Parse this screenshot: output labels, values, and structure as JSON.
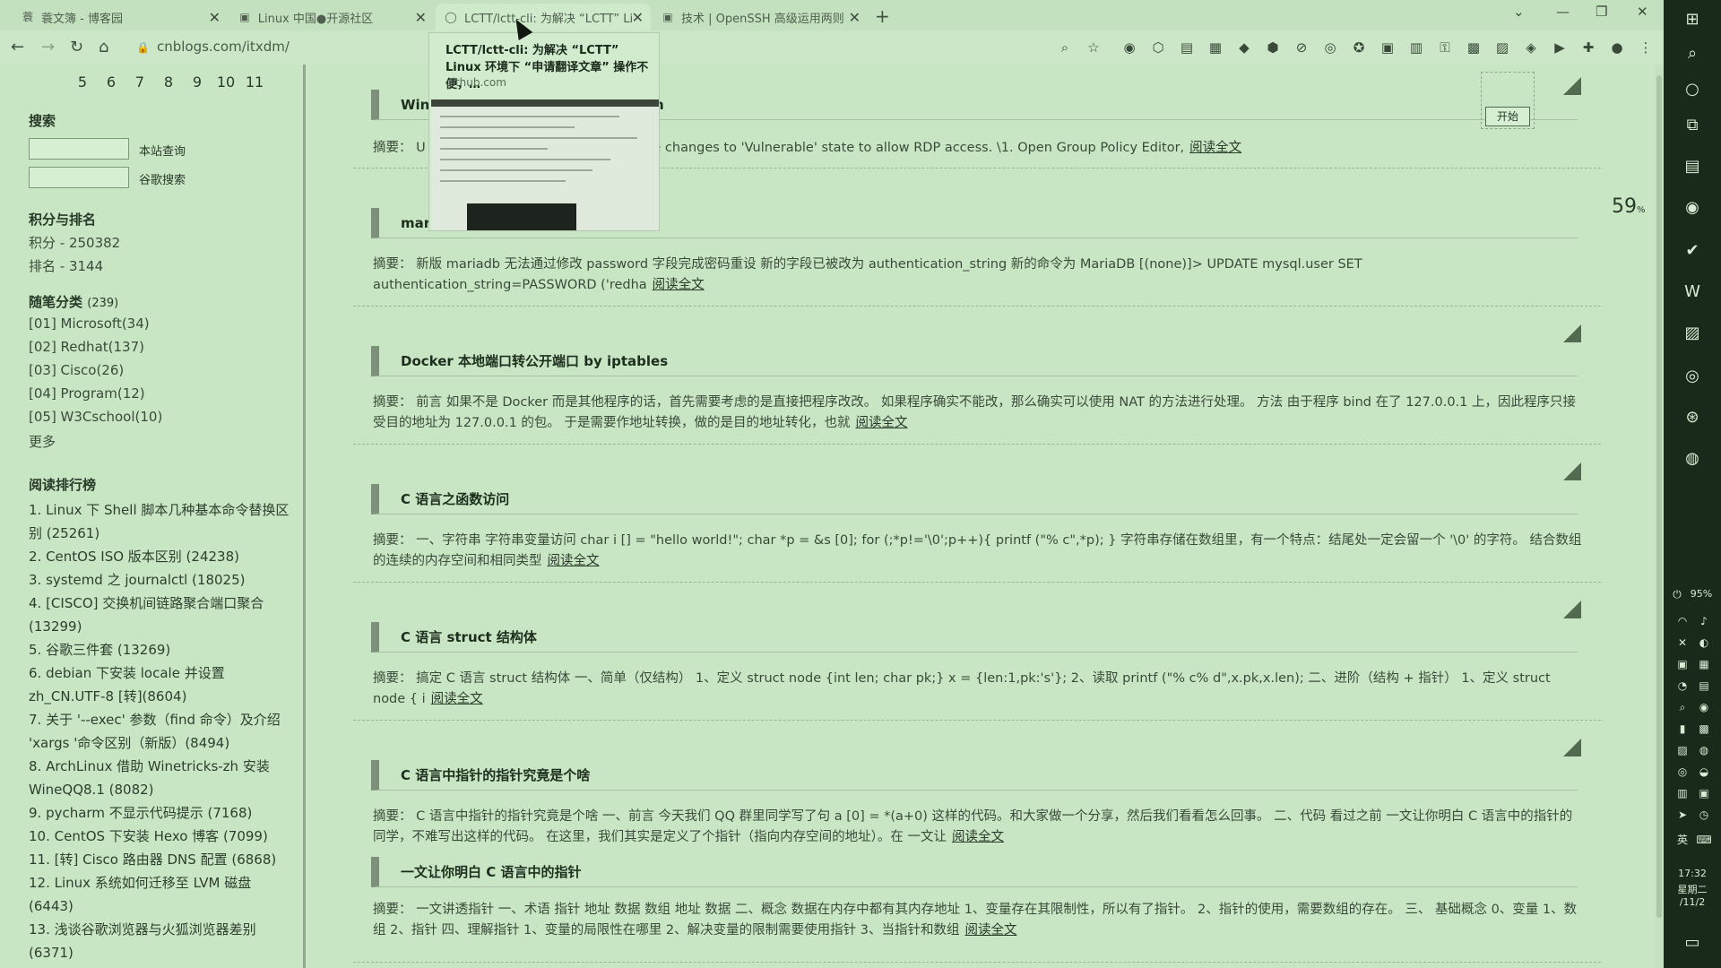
{
  "tabs": [
    {
      "icon": "蓑",
      "label": "蓑文簿 - 博客园",
      "active": false
    },
    {
      "icon": "▣",
      "label": "Linux 中国●开源社区",
      "active": false
    },
    {
      "icon": "◯",
      "label": "LCTT/lctt-cli: 为解决 “LCTT” Li",
      "active": true
    },
    {
      "icon": "▣",
      "label": "技术 | OpenSSH 高级运用两则",
      "active": false
    }
  ],
  "address": {
    "url": "cnblogs.com/itxdm/"
  },
  "preview": {
    "title": "LCTT/lctt-cli: 为解决 “LCTT” Linux 环境下 “申请翻译文章” 操作不便，…",
    "domain": "github.com"
  },
  "sidebar": {
    "pages": [
      "5",
      "6",
      "7",
      "8",
      "9",
      "10",
      "11"
    ],
    "search_heading": "搜索",
    "site_search": "本站查询",
    "google_search": "谷歌搜索",
    "score_heading": "积分与排名",
    "score": "积分 - 250382",
    "rank": "排名 - 3144",
    "cat_heading": "随笔分类",
    "cat_count": "(239)",
    "categories": [
      "[01] Microsoft(34)",
      "[02] Redhat(137)",
      "[03] Cisco(26)",
      "[04] Program(12)",
      "[05] W3Cschool(10)",
      "更多"
    ],
    "top_heading": "阅读排行榜",
    "top": [
      "1. Linux 下 Shell 脚本几种基本命令替换区别 (25261)",
      "2. CentOS ISO 版本区别 (24238)",
      "3. systemd 之 journalctl (18025)",
      "4. [CISCO] 交换机间链路聚合端口聚合 (13299)",
      "5. 谷歌三件套 (13269)",
      "6. debian 下安装 locale 并设置 zh_CN.UTF-8 [转](8604)",
      "7. 关于 '--exec' 参数（find 命令）及介绍 'xargs '命令区别（新版）(8494)",
      "8. ArchLinux 借助 Winetricks-zh 安装 WineQQ8.1 (8082)",
      "9. pycharm 不显示代码提示 (7168)",
      "10. CentOS 下安装 Hexo 博客 (7099)",
      "11. [转] Cisco 路由器 DNS 配置 (6868)",
      "12. Linux 系统如何迁移至 LVM 磁盘 (6443)",
      "13. 浅谈谷歌浏览器与火狐浏览器差别 (6371)"
    ]
  },
  "posts": [
    {
      "title": "Win                                                       encryption oracle remediation",
      "summary": "摘要： U                                            ges described below to rollback the changes to 'Vulnerable' state to allow RDP access. \\1. Open Group Policy Editor,",
      "more": "阅读全文"
    },
    {
      "title": "mar                                                      root 密码",
      "summary": "摘要： 新版 mariadb 无法通过修改 password 字段完成密码重设 新的字段已被改为 authentication_string 新的命令为 MariaDB [(none)]> UPDATE mysql.user SET authentication_string=PASSWORD ('redha",
      "more": "阅读全文"
    },
    {
      "title": "Docker 本地端口转公开端口 by iptables",
      "summary": "摘要： 前言 如果不是 Docker 而是其他程序的话，首先需要考虑的是直接把程序改改。 如果程序确实不能改，那么确实可以使用 NAT 的方法进行处理。 方法 由于程序 bind 在了 127.0.0.1 上，因此程序只接受目的地址为 127.0.0.1 的包。 于是需要作地址转换，做的是目的地址转化，也就",
      "more": "阅读全文"
    },
    {
      "title": "C 语言之函数访问",
      "summary": "摘要： 一、字符串 字符串变量访问 char i [] = \"hello world!\"; char *p = &s [0]; for (;*p!='\\0';p++){ printf (\"% c\",*p); } 字符串存储在数组里，有一个特点：结尾处一定会留一个 '\\0' 的字符。 结合数组的连续的内存空间和相同类型",
      "more": "阅读全文"
    },
    {
      "title": "C 语言 struct 结构体",
      "summary": "摘要： 搞定 C 语言 struct 结构体 一、简单（仅结构） 1、定义 struct node {int len; char pk;} x = {len:1,pk:'s'}; 2、读取 printf (\"% c% d\",x.pk,x.len); 二、进阶（结构 + 指针） 1、定义 struct node { i",
      "more": "阅读全文"
    },
    {
      "title": "C 语言中指针的指针究竟是个啥",
      "summary": "摘要： C 语言中指针的指针究竟是个啥 一、前言 今天我们 QQ 群里同学写了句 a [0] = *(a+0) 这样的代码。和大家做一个分享，然后我们看看怎么回事。 二、代码 看过之前 一文让你明白 C 语言中的指针的同学，不难写出这样的代码。 在这里，我们其实是定义了个指针（指向内存空间的地址）。在 一文让",
      "more": "阅读全文"
    },
    {
      "title": "一文让你明白 C 语言中的指针",
      "summary": "摘要： 一文讲透指针 一、术语 指针 地址 数据 数组 地址 数据 二、概念 数据在内存中都有其内存地址 1、变量存在其限制性，所以有了指针。 2、指针的使用，需要数组的存在。 三、 基础概念 0、变量 1、数组 2、指针 四、理解指针 1、变量的局限性在哪里 2、解决变量的限制需要使用指针 3、当指针和数组",
      "more": "阅读全文"
    }
  ],
  "widget": {
    "button": "开始"
  },
  "meter": {
    "value": "59",
    "unit": "%"
  },
  "taskbar": {
    "battery": "95%",
    "ime": "英",
    "time": "17:32",
    "weekday": "星期二",
    "date": "/11/2"
  }
}
